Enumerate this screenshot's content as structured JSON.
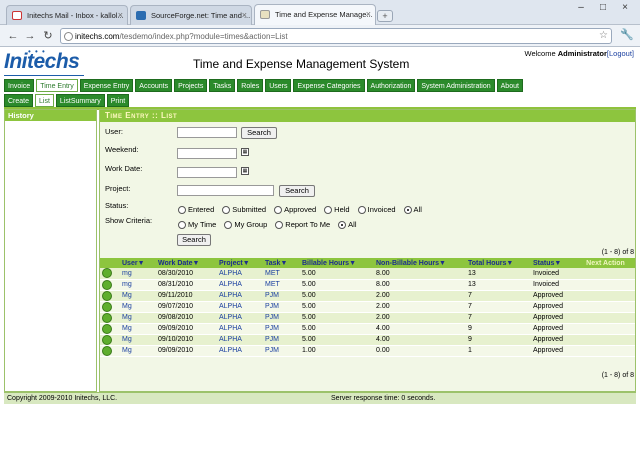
{
  "browser": {
    "tabs": [
      {
        "title": "Initechs Mail - Inbox - kallol...",
        "icon": "gmail-icon"
      },
      {
        "title": "SourceForge.net: Time and ...",
        "icon": "sourceforge-icon"
      },
      {
        "title": "Time and Expense Manage...",
        "icon": "page-icon"
      }
    ],
    "new_tab": "+",
    "url_host": "initechs.com",
    "url_path": "/tesdemo/index.php?module=times&action=List"
  },
  "header": {
    "logo": "Initechs",
    "app_title": "Time and Expense Management System",
    "welcome_prefix": "Welcome ",
    "user": "Administrator",
    "logout": "[Logout]"
  },
  "menu": {
    "main": [
      "Invoice",
      "Time Entry",
      "Expense Entry",
      "Accounts",
      "Projects",
      "Tasks",
      "Roles",
      "Users",
      "Expense Categories",
      "Authorization",
      "System Administration",
      "About"
    ],
    "sub": [
      "Create",
      "List",
      "ListSummary",
      "Print"
    ]
  },
  "sidebar": {
    "title": "History"
  },
  "main": {
    "title": "Time Entry :: List",
    "user_label": "User:",
    "weekend_label": "Weekend:",
    "work_date_label": "Work Date:",
    "project_label": "Project:",
    "status_label": "Status:",
    "show_label": "Show Criteria:",
    "search": "Search",
    "status_options": [
      "Entered",
      "Submitted",
      "Approved",
      "Held",
      "Invoiced",
      "All"
    ],
    "show_options": [
      "My Time",
      "My Group",
      "Report To Me",
      "All"
    ],
    "count": "(1 - 8) of 8"
  },
  "table": {
    "headers": [
      "User",
      "Work Date",
      "Project",
      "Task",
      "Billable Hours",
      "Non-Billable Hours",
      "Total Hours",
      "Status",
      "Next Action"
    ],
    "sort_arrow": "▼",
    "rows": [
      [
        "mg",
        "08/30/2010",
        "ALPHA",
        "MET",
        "5.00",
        "8.00",
        "13",
        "Invoiced"
      ],
      [
        "mg",
        "08/31/2010",
        "ALPHA",
        "MET",
        "5.00",
        "8.00",
        "13",
        "Invoiced"
      ],
      [
        "Mg",
        "09/11/2010",
        "ALPHA",
        "PJM",
        "5.00",
        "2.00",
        "7",
        "Approved"
      ],
      [
        "Mg",
        "09/07/2010",
        "ALPHA",
        "PJM",
        "5.00",
        "2.00",
        "7",
        "Approved"
      ],
      [
        "Mg",
        "09/08/2010",
        "ALPHA",
        "PJM",
        "5.00",
        "2.00",
        "7",
        "Approved"
      ],
      [
        "Mg",
        "09/09/2010",
        "ALPHA",
        "PJM",
        "5.00",
        "4.00",
        "9",
        "Approved"
      ],
      [
        "Mg",
        "09/10/2010",
        "ALPHA",
        "PJM",
        "5.00",
        "4.00",
        "9",
        "Approved"
      ],
      [
        "Mg",
        "09/09/2010",
        "ALPHA",
        "PJM",
        "1.00",
        "0.00",
        "1",
        "Approved"
      ]
    ]
  },
  "footer": {
    "copyright": "Copyright 2009-2010 Initechs, LLC.",
    "response": "Server response time: 0 seconds."
  }
}
